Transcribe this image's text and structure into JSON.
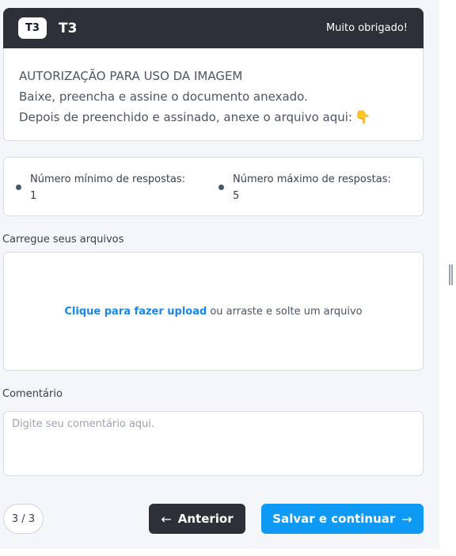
{
  "header": {
    "badge": "T3",
    "title": "T3",
    "thanks": "Muito obrigado!"
  },
  "description": {
    "lines": [
      "AUTORIZAÇÃO PARA USO DA IMAGEM",
      "Baixe, preencha e assine o documento anexado.",
      "Depois de preenchido e assinado, anexe o arquivo aqui:"
    ],
    "emoji": "👇"
  },
  "limits": {
    "min_label": "Número mínimo de respostas:",
    "min_value": "1",
    "max_label": "Número máximo de respostas:",
    "max_value": "5"
  },
  "upload": {
    "label": "Carregue seus arquivos",
    "link_text": "Clique para fazer upload",
    "rest_text": "ou arraste e solte um arquivo"
  },
  "comment": {
    "label": "Comentário",
    "placeholder": "Digite seu comentário aqui."
  },
  "footer": {
    "page_indicator": "3 / 3",
    "prev_label": "Anterior",
    "next_label": "Salvar e continuar",
    "prev_icon": "arrow-left-icon",
    "next_icon": "arrow-right-icon"
  },
  "colors": {
    "header_bg": "#2d3039",
    "accent": "#0e99f5",
    "link": "#1a87e6",
    "page_bg": "#f5f6fa"
  }
}
